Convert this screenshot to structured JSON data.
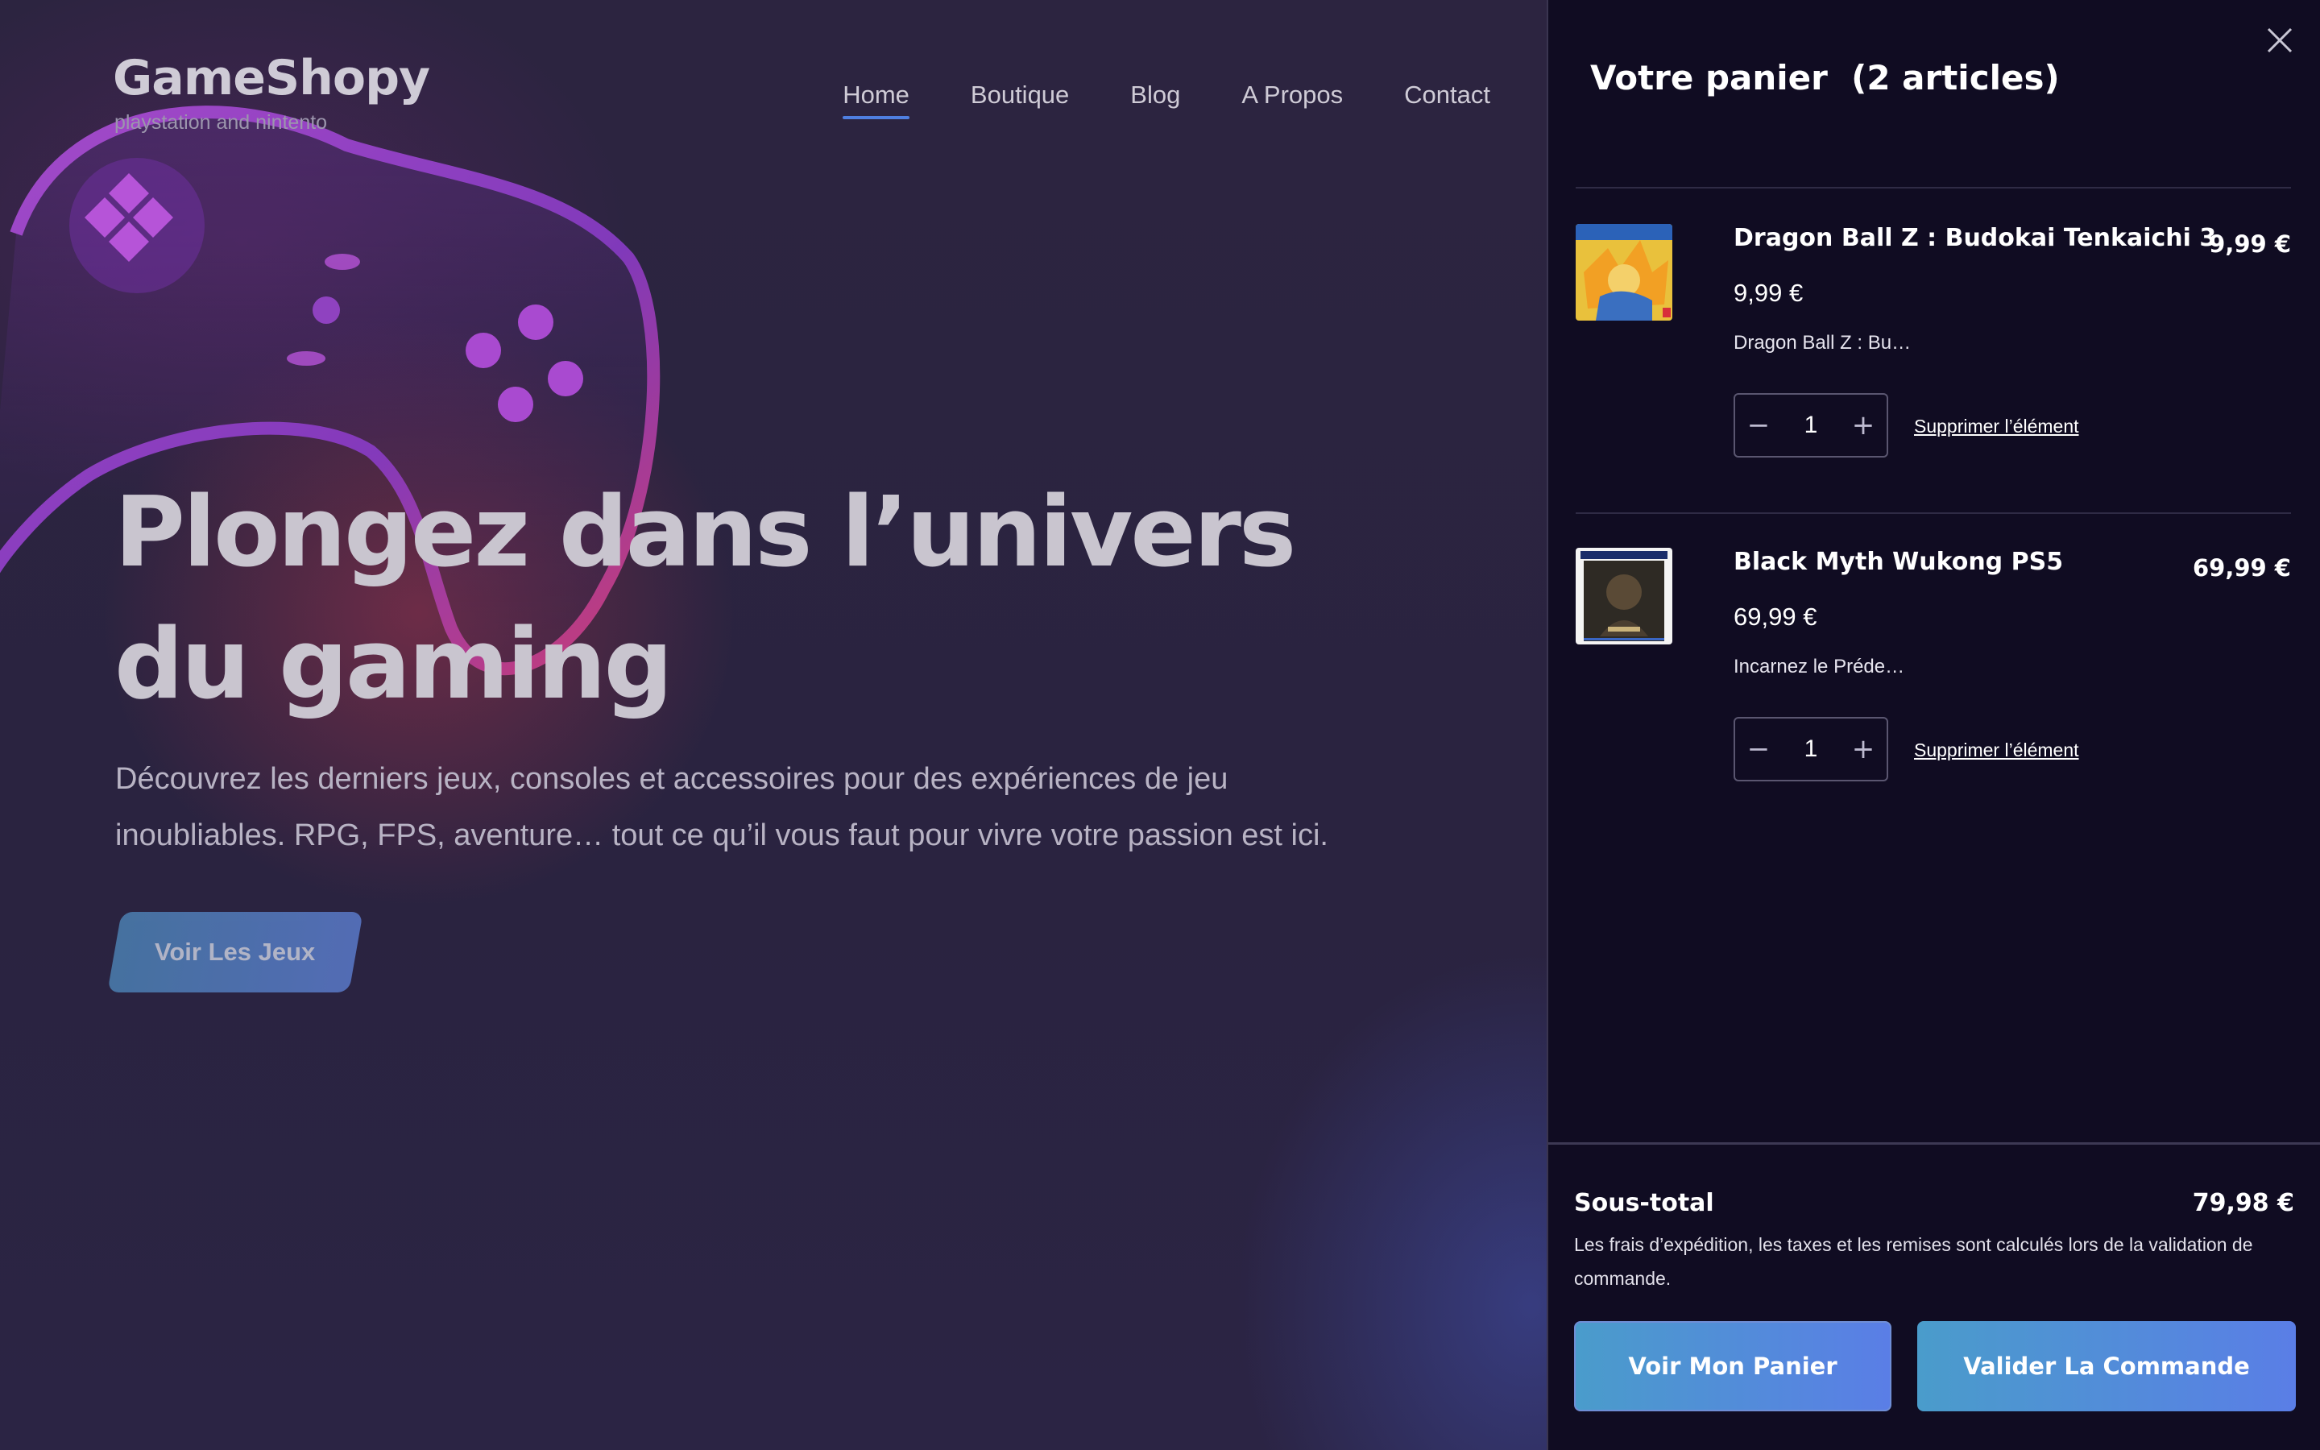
{
  "brand": {
    "name": "GameShopy",
    "tagline": "playstation and nintento"
  },
  "nav": {
    "items": [
      {
        "label": "Home",
        "active": true
      },
      {
        "label": "Boutique",
        "active": false
      },
      {
        "label": "Blog",
        "active": false
      },
      {
        "label": "A Propos",
        "active": false
      },
      {
        "label": "Contact",
        "active": false
      }
    ]
  },
  "hero": {
    "title_line1": "Plongez dans l’univers",
    "title_line2": "du gaming",
    "text_line1": "Découvrez les derniers jeux, consoles et accessoires pour des expériences de jeu",
    "text_line2": "inoubliables. RPG, FPS, aventure… tout ce qu’il vous faut pour vivre votre passion est ici.",
    "cta_label": "Voir Les Jeux"
  },
  "cart": {
    "title": "Votre panier",
    "count_label": "(2 articles)",
    "items": [
      {
        "name": "Dragon Ball Z : Budokai Tenkaichi 3",
        "line_total": "9,99 €",
        "price": "9,99 €",
        "description": "Dragon Ball Z : Bu…",
        "quantity": "1",
        "remove_label": "Supprimer l’élément",
        "thumb_icon": "dragon-ball-cover"
      },
      {
        "name": "Black Myth Wukong PS5",
        "line_total": "69,99 €",
        "price": "69,99 €",
        "description": "Incarnez le Préde…",
        "quantity": "1",
        "remove_label": "Supprimer l’élément",
        "thumb_icon": "black-myth-wukong-cover"
      }
    ],
    "subtotal_label": "Sous-total",
    "subtotal_value": "79,98 €",
    "shipping_note": "Les frais d’expédition, les taxes et les remises sont calculés lors de la validation de commande.",
    "view_cart_label": "Voir Mon Panier",
    "checkout_label": "Valider La Commande"
  },
  "colors": {
    "accent": "#4f7fe0",
    "drawer_bg": "#100c22",
    "page_bg": "#2a223d",
    "button_gradient_start": "#4a9ccb",
    "button_gradient_end": "#5a7ee6"
  }
}
